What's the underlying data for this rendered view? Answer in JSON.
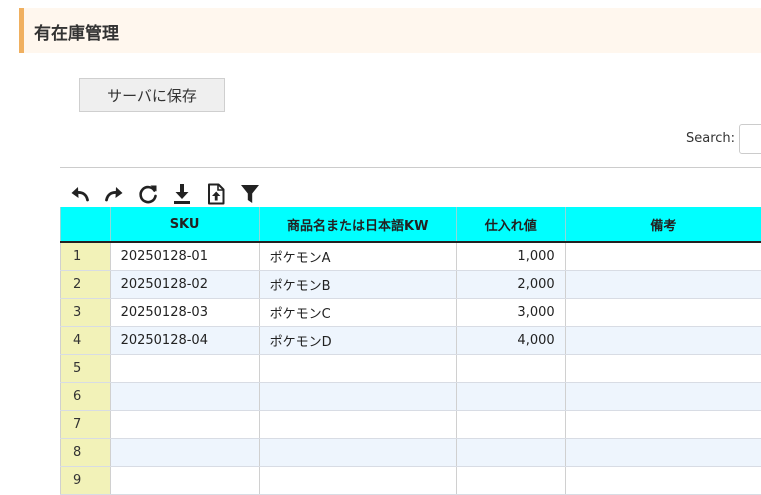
{
  "header": {
    "title": "有在庫管理"
  },
  "actions": {
    "save_label": "サーバに保存"
  },
  "search": {
    "label": "Search:",
    "value": ""
  },
  "toolbar": {
    "icons": [
      "undo-icon",
      "redo-icon",
      "refresh-icon",
      "download-icon",
      "upload-file-icon",
      "filter-icon"
    ]
  },
  "table": {
    "columns": [
      "",
      "SKU",
      "商品名または日本語KW",
      "仕入れ値",
      "備考"
    ],
    "rows": [
      {
        "num": "1",
        "sku": "20250128-01",
        "name": "ポケモンA",
        "price": "1,000",
        "note": ""
      },
      {
        "num": "2",
        "sku": "20250128-02",
        "name": "ポケモンB",
        "price": "2,000",
        "note": ""
      },
      {
        "num": "3",
        "sku": "20250128-03",
        "name": "ポケモンC",
        "price": "3,000",
        "note": ""
      },
      {
        "num": "4",
        "sku": "20250128-04",
        "name": "ポケモンD",
        "price": "4,000",
        "note": ""
      },
      {
        "num": "5",
        "sku": "",
        "name": "",
        "price": "",
        "note": ""
      },
      {
        "num": "6",
        "sku": "",
        "name": "",
        "price": "",
        "note": ""
      },
      {
        "num": "7",
        "sku": "",
        "name": "",
        "price": "",
        "note": ""
      },
      {
        "num": "8",
        "sku": "",
        "name": "",
        "price": "",
        "note": ""
      },
      {
        "num": "9",
        "sku": "",
        "name": "",
        "price": "",
        "note": ""
      }
    ]
  }
}
